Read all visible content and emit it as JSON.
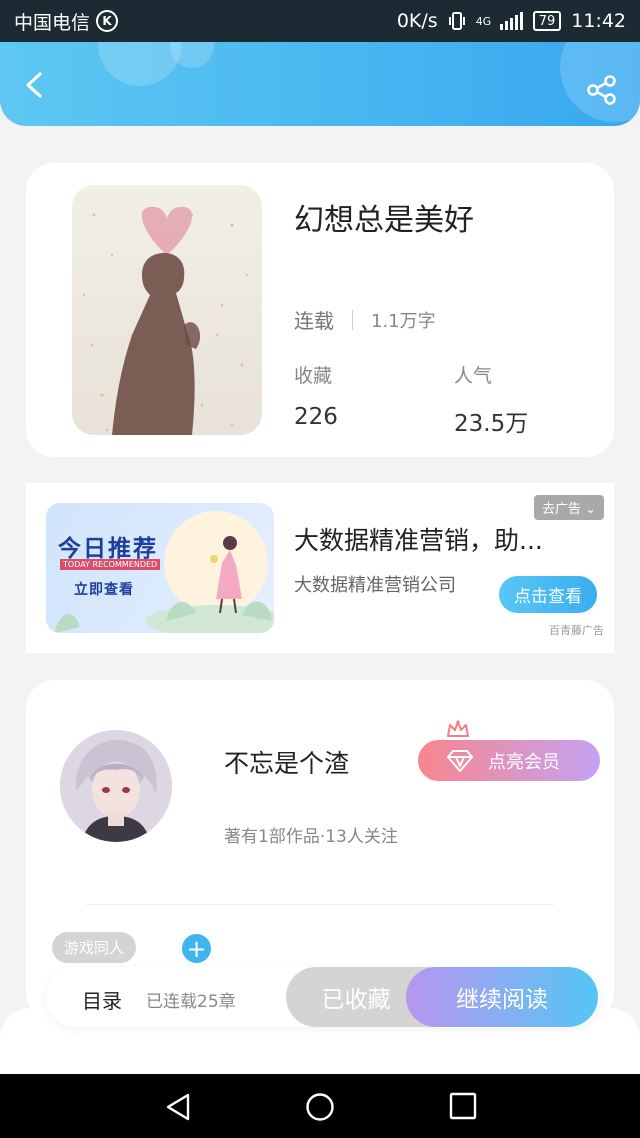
{
  "status_bar": {
    "carrier": "中国电信",
    "carrier_badge": "K",
    "net_speed": "0K/s",
    "network": "4G",
    "battery": "79",
    "time": "11:42"
  },
  "header": {
    "back_icon": "back-chevron-icon",
    "share_icon": "share-icon"
  },
  "book": {
    "title": "幻想总是美好",
    "status": "连载",
    "word_count": "1.1万字",
    "favorites_label": "收藏",
    "favorites_value": "226",
    "popularity_label": "人气",
    "popularity_value": "23.5万"
  },
  "ad": {
    "banner_title": "今日推荐",
    "banner_subtitle": "TODAY RECOMMENDED",
    "banner_cta": "立即查看",
    "title": "大数据精准营销，助...",
    "company": "大数据精准营销公司",
    "remove_ad": "去广告",
    "cta": "点击查看",
    "source": "百青藤广告"
  },
  "author": {
    "name": "不忘是个渣",
    "stats": "著有1部作品·13人关注",
    "vip_button": "点亮会员",
    "tag": "游戏同人",
    "add_tag": "+"
  },
  "action_bar": {
    "toc": "目录",
    "chapters": "已连载25章",
    "collected": "已收藏",
    "continue_reading": "继续阅读"
  },
  "colors": {
    "header_start": "#5ec8f2",
    "header_end": "#37a8ef",
    "vip_start": "#f7868c",
    "vip_end": "#c4a2f3",
    "read_start": "#b896ef",
    "read_end": "#54c6f5"
  }
}
